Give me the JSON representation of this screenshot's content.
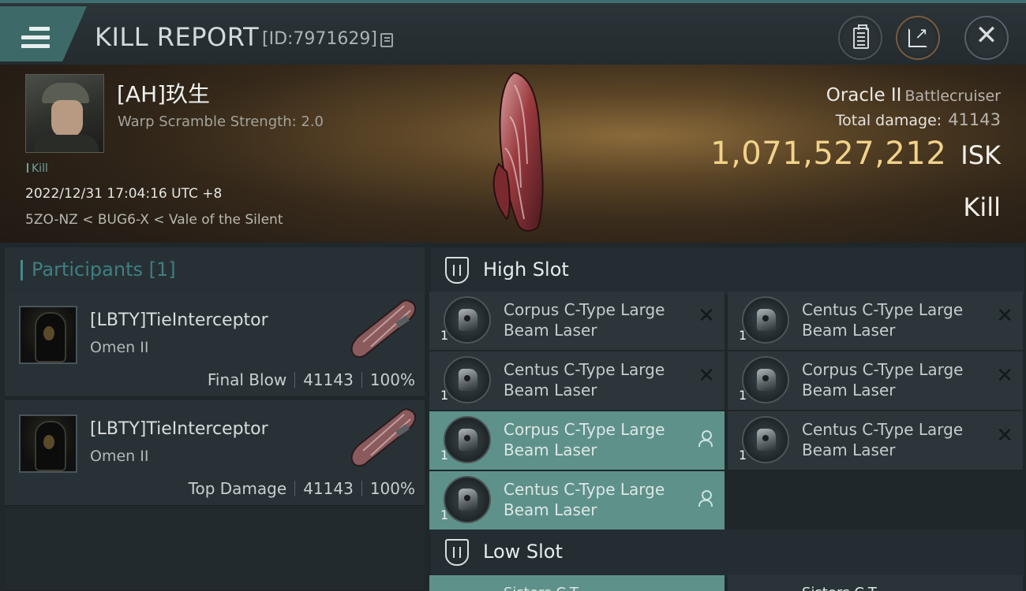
{
  "header": {
    "title": "KILL REPORT",
    "report_id": "[ID:7971629]"
  },
  "victim": {
    "name": "[AH]玖生",
    "warp_scramble": "Warp Scramble Strength: 2.0",
    "tag": "Kill",
    "datetime": "2022/12/31 17:04:16 UTC +8",
    "location": "5ZO-NZ < BUG6-X < Vale of the Silent",
    "ship_name": "Oracle II",
    "ship_class": "Battlecruiser",
    "total_damage_label": "Total damage:",
    "total_damage": "41143",
    "isk_value": "1,071,527,212",
    "isk_unit": "ISK",
    "kill_type": "Kill"
  },
  "participants": {
    "title": "Participants [1]",
    "rows": [
      {
        "name": "[LBTY]TieInterceptor",
        "ship": "Omen II",
        "role": "Final Blow",
        "damage": "41143",
        "percent": "100%"
      },
      {
        "name": "[LBTY]TieInterceptor",
        "ship": "Omen II",
        "role": "Top Damage",
        "damage": "41143",
        "percent": "100%"
      }
    ]
  },
  "slots": {
    "high": {
      "label": "High Slot",
      "modules": [
        {
          "name": "Corpus C-Type Large Beam Laser",
          "qty": "1",
          "status": "destroyed"
        },
        {
          "name": "Centus C-Type Large Beam Laser",
          "qty": "1",
          "status": "destroyed"
        },
        {
          "name": "Centus C-Type Large Beam Laser",
          "qty": "1",
          "status": "destroyed"
        },
        {
          "name": "Corpus C-Type Large Beam Laser",
          "qty": "1",
          "status": "destroyed"
        },
        {
          "name": "Corpus C-Type Large Beam Laser",
          "qty": "1",
          "status": "dropped"
        },
        {
          "name": "Centus C-Type Large Beam Laser",
          "qty": "1",
          "status": "destroyed"
        },
        {
          "name": "Centus C-Type Large Beam Laser",
          "qty": "1",
          "status": "dropped"
        }
      ]
    },
    "low": {
      "label": "Low Slot",
      "peek": [
        "Sisters C-T",
        "Sisters C-T"
      ]
    }
  },
  "colors": {
    "accent_teal": "#5e918a",
    "isk_gold": "#f0d28a",
    "menu_tab": "#3d6a68"
  },
  "icons": [
    "menu-icon",
    "copy-icon",
    "clipboard-icon",
    "share-icon",
    "close-icon",
    "slot-shield-icon",
    "pilot-icon",
    "module-icon",
    "destroyed-x-icon",
    "dropped-person-icon"
  ]
}
